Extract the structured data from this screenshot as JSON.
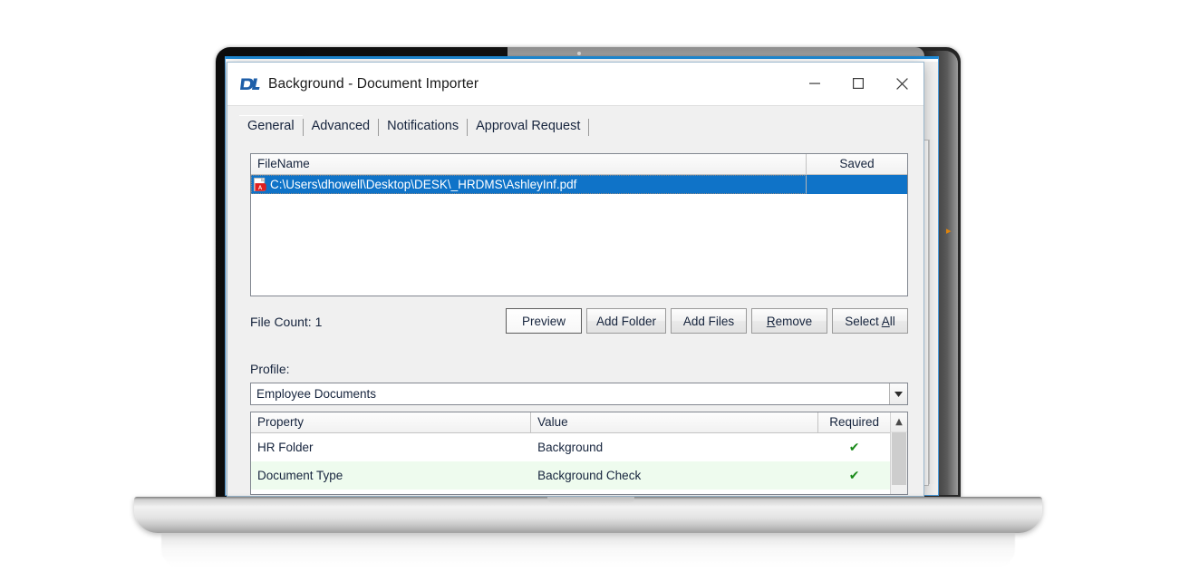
{
  "window": {
    "title": "Background - Document Importer",
    "app_icon": "dl-logo-icon",
    "controls": {
      "minimize": "minimize-icon",
      "maximize": "maximize-icon",
      "close": "close-icon"
    }
  },
  "tabs": [
    {
      "label": "General",
      "selected": true
    },
    {
      "label": "Advanced",
      "selected": false
    },
    {
      "label": "Notifications",
      "selected": false
    },
    {
      "label": "Approval Request",
      "selected": false
    }
  ],
  "file_list": {
    "columns": [
      "FileName",
      "Saved"
    ],
    "rows": [
      {
        "icon": "pdf-file-icon",
        "filename": "C:\\Users\\dhowell\\Desktop\\DESK\\_HRDMS\\AshleyInf.pdf",
        "saved": "",
        "selected": true
      }
    ]
  },
  "actions": {
    "file_count_label": "File Count: 1",
    "buttons": [
      {
        "label": "Preview",
        "accel": "",
        "default": true
      },
      {
        "label": "Add Folder",
        "accel": "",
        "default": false
      },
      {
        "label": "Add Files",
        "accel": "",
        "default": false
      },
      {
        "label": "Remove",
        "accel": "R",
        "default": false
      },
      {
        "label": "Select All",
        "accel": "A",
        "default": false
      }
    ]
  },
  "profile": {
    "label": "Profile:",
    "value": "Employee Documents",
    "dropdown_icon": "chevron-down-icon"
  },
  "properties": {
    "columns": [
      "Property",
      "Value",
      "Required"
    ],
    "rows": [
      {
        "property": "HR Folder",
        "value": "Background",
        "required": "✔"
      },
      {
        "property": "Document Type",
        "value": "Background Check",
        "required": "✔"
      }
    ],
    "scroll_up_icon": "chevron-up-icon"
  },
  "colors": {
    "selection_blue": "#0f73c8",
    "title_accent": "#1e8ad6",
    "required_check_green": "#1a8a1a",
    "alt_row_green": "#eefbee",
    "pdf_icon_red": "#e02020",
    "splitter_arrow_orange": "#e0840b"
  },
  "background_window": {
    "splitter_arrow": "▸"
  }
}
